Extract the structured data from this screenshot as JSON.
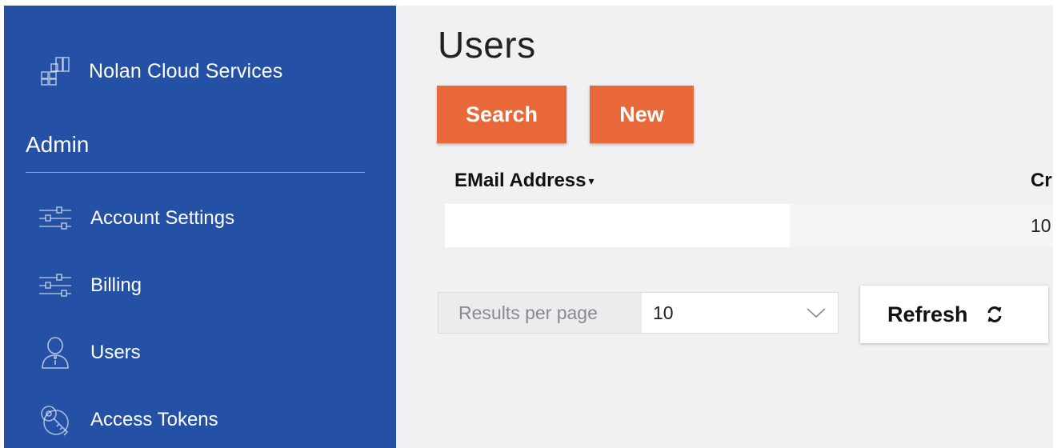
{
  "sidebar": {
    "brand_name": "Nolan Cloud Services",
    "brand_icon": "buildings-icon",
    "section_title": "Admin",
    "items": [
      {
        "label": "Account Settings",
        "icon": "sliders-icon"
      },
      {
        "label": "Billing",
        "icon": "sliders-icon"
      },
      {
        "label": "Users",
        "icon": "user-icon"
      },
      {
        "label": "Access Tokens",
        "icon": "key-icon"
      }
    ]
  },
  "main": {
    "title": "Users",
    "search_label": "Search",
    "new_label": "New",
    "table": {
      "columns": [
        "EMail Address",
        "Cr"
      ],
      "sort_indicator": "▾",
      "rows": [
        {
          "email": "",
          "created": "10"
        }
      ]
    },
    "pagination": {
      "results_label": "Results per page",
      "results_value": "10"
    },
    "refresh_label": "Refresh"
  },
  "colors": {
    "sidebar_bg": "#2451a6",
    "accent_orange": "#e8683a",
    "main_bg": "#f1f1f3"
  }
}
